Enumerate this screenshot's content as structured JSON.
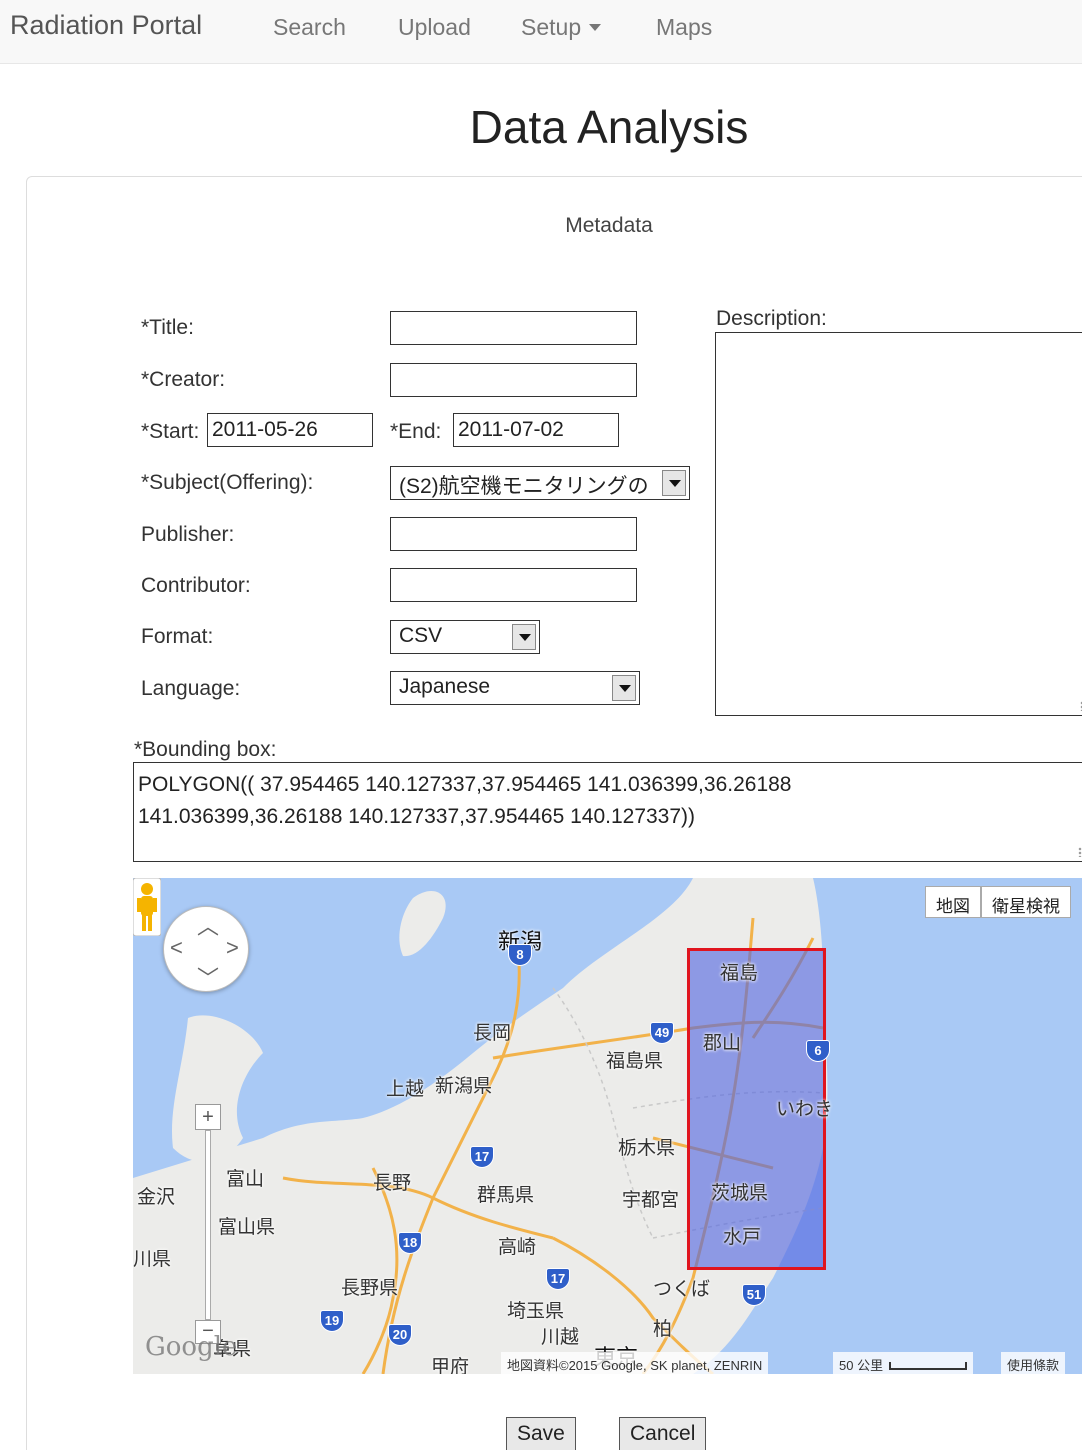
{
  "navbar": {
    "brand": "Radiation Portal",
    "links": [
      "Search",
      "Upload",
      "Setup",
      "Maps"
    ]
  },
  "page": {
    "title": "Data Analysis",
    "section": "Metadata"
  },
  "form": {
    "title_label": "*Title:",
    "title_value": "",
    "creator_label": "*Creator:",
    "creator_value": "",
    "start_label": "*Start:",
    "start_value": "2011-05-26",
    "end_label": "*End:",
    "end_value": "2011-07-02",
    "subject_label": "*Subject(Offering):",
    "subject_value": "(S2)航空機モニタリングの",
    "publisher_label": "Publisher:",
    "publisher_value": "",
    "contributor_label": "Contributor:",
    "contributor_value": "",
    "format_label": "Format:",
    "format_value": "CSV",
    "language_label": "Language:",
    "language_value": "Japanese",
    "description_label": "Description:",
    "bbox_label": "*Bounding box:",
    "bbox_line1": "POLYGON(( 37.954465 140.127337,37.954465 141.036399,36.26188",
    "bbox_line2": "141.036399,36.26188 140.127337,37.954465 140.127337))"
  },
  "map": {
    "type_map": "地図",
    "type_satellite": "衛星検視",
    "labels": {
      "niigata_city": "新潟",
      "nagaoka": "長岡",
      "fukushima_pref": "福島県",
      "fukushima_city": "福島",
      "koriyama": "郡山",
      "iwaki": "いわき",
      "joetsu": "上越",
      "niigata_pref": "新潟県",
      "tochigi_pref": "栃木県",
      "toyama": "富山",
      "toyama_pref": "富山県",
      "kanazawa": "金沢",
      "ishikawa_pref": "川県",
      "nagano": "長野",
      "gunma_pref": "群馬県",
      "utsunomiya": "宇都宮",
      "ibaraki_pref": "茨城県",
      "mito": "水戸",
      "takasaki": "高崎",
      "nagano_pref": "長野県",
      "saitama_pref": "埼玉県",
      "tsukuba": "つくば",
      "kawagoe": "川越",
      "kashiwa": "柏",
      "tokyo": "東京",
      "kofu": "甲府",
      "gifu_pref": "阜県"
    },
    "routes": [
      "8",
      "49",
      "6",
      "17",
      "18",
      "17",
      "51",
      "19",
      "20"
    ],
    "logo": "Google",
    "attribution": "地図資料©2015 Google, SK planet, ZENRIN",
    "scale": "50 公里",
    "terms": "使用條款",
    "colors": {
      "land": "#ececea",
      "sea": "#a9c9f5",
      "road": "#f2b24a",
      "bbox_stroke": "#e0141e",
      "bbox_fill": "#5366e0"
    }
  },
  "actions": {
    "save": "Save",
    "cancel": "Cancel"
  }
}
